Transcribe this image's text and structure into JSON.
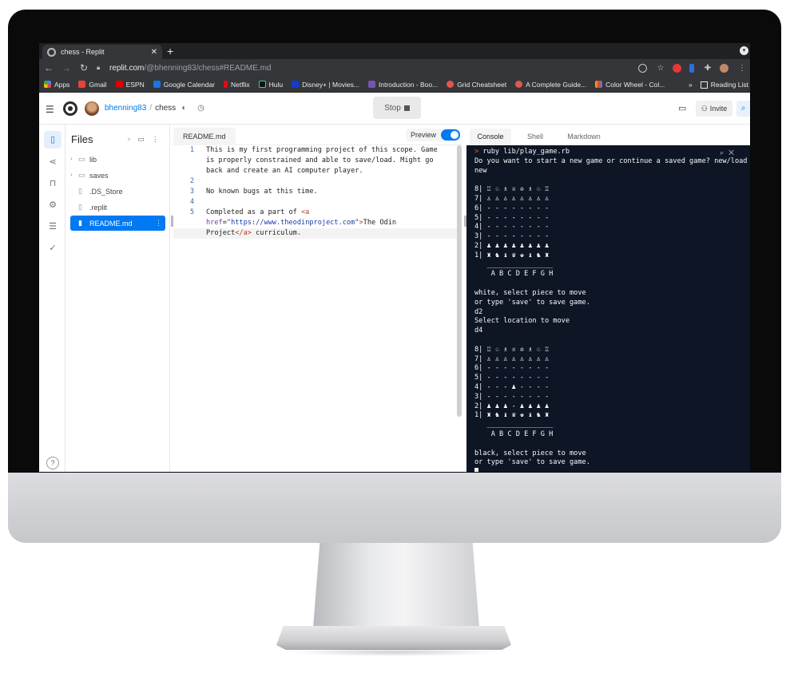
{
  "browser": {
    "tab_title": "chess - Replit",
    "new_tab": "+",
    "url_host": "replit.com",
    "url_path": "/@bhenning83/chess#README.md",
    "bookmarks": [
      {
        "label": "Apps",
        "color": "#4285f4"
      },
      {
        "label": "Gmail",
        "color": "#ea4335"
      },
      {
        "label": "ESPN",
        "color": "#d00"
      },
      {
        "label": "Google Calendar",
        "color": "#1a73e8"
      },
      {
        "label": "Netflix",
        "color": "#e50914"
      },
      {
        "label": "Hulu",
        "color": "#1ce783"
      },
      {
        "label": "Disney+ | Movies...",
        "color": "#113ccf"
      },
      {
        "label": "Introduction - Boo...",
        "color": "#7952b3"
      },
      {
        "label": "Grid Cheatsheet",
        "color": "#e2574c"
      },
      {
        "label": "A Complete Guide...",
        "color": "#e2574c"
      },
      {
        "label": "Color Wheel - Col...",
        "color": "#f4b400"
      }
    ],
    "bookmarks_more": "»",
    "reading_list": "Reading List"
  },
  "header": {
    "username": "bhenning83",
    "separator": "/",
    "repl_name": "chess",
    "stop_label": "Stop",
    "invite_label": "Invite"
  },
  "files": {
    "title": "Files",
    "items": [
      {
        "label": "lib",
        "type": "folder"
      },
      {
        "label": "saves",
        "type": "folder"
      },
      {
        "label": ".DS_Store",
        "type": "file"
      },
      {
        "label": ".replit",
        "type": "file"
      },
      {
        "label": "README.md",
        "type": "file",
        "selected": true
      }
    ],
    "help": "?"
  },
  "editor": {
    "tab": "README.md",
    "preview_label": "Preview",
    "preview_on": true,
    "line_numbers": [
      "1",
      "2",
      "3",
      "4",
      "5"
    ],
    "lines": {
      "l1a": "This is my first programming project of this scope. Game",
      "l1b": "is properly constrained and able to save/load. Might go",
      "l1c": "back and create an AI computer player.",
      "l3": "No known bugs at this time.",
      "l5a_text": "Completed as a part of ",
      "l5a_tag": "<a",
      "l5b_attr": "href",
      "l5b_eq": "=",
      "l5b_str": "\"https://www.theodinproject.com\"",
      "l5b_tagclose": ">",
      "l5b_text": "The Odin",
      "l5c_text": "Project",
      "l5c_tag": "</a>",
      "l5c_rest": " curriculum."
    }
  },
  "console": {
    "tabs": [
      "Console",
      "Shell",
      "Markdown"
    ],
    "prompt_symbol": ">",
    "command": " ruby lib/play_game.rb",
    "output": "Do you want to start a new game or continue a saved game? new/load\nnew\n\n8| ♖ ♘ ♗ ♕ ♔ ♗ ♘ ♖\n7| ♙ ♙ ♙ ♙ ♙ ♙ ♙ ♙\n6| - - - - - - - -\n5| - - - - - - - -\n4| - - - - - - - -\n3| - - - - - - - -\n2| ♟ ♟ ♟ ♟ ♟ ♟ ♟ ♟\n1| ♜ ♞ ♝ ♛ ♚ ♝ ♞ ♜\n   ________________\n    A B C D E F G H\n\nwhite, select piece to move\nor type 'save' to save game.\nd2\nSelect location to move\nd4\n\n8| ♖ ♘ ♗ ♕ ♔ ♗ ♘ ♖\n7| ♙ ♙ ♙ ♙ ♙ ♙ ♙ ♙\n6| - - - - - - - -\n5| - - - - - - - -\n4| - - - ♟ - - - -\n3| - - - - - - - -\n2| ♟ ♟ ♟ - ♟ ♟ ♟ ♟\n1| ♜ ♞ ♝ ♛ ♚ ♝ ♞ ♜\n   ________________\n    A B C D E F G H\n\nblack, select piece to move\nor type 'save' to save game."
  },
  "colors": {
    "accent": "#0079f2",
    "console_bg": "#0e1525",
    "prompt": "#f26207"
  }
}
